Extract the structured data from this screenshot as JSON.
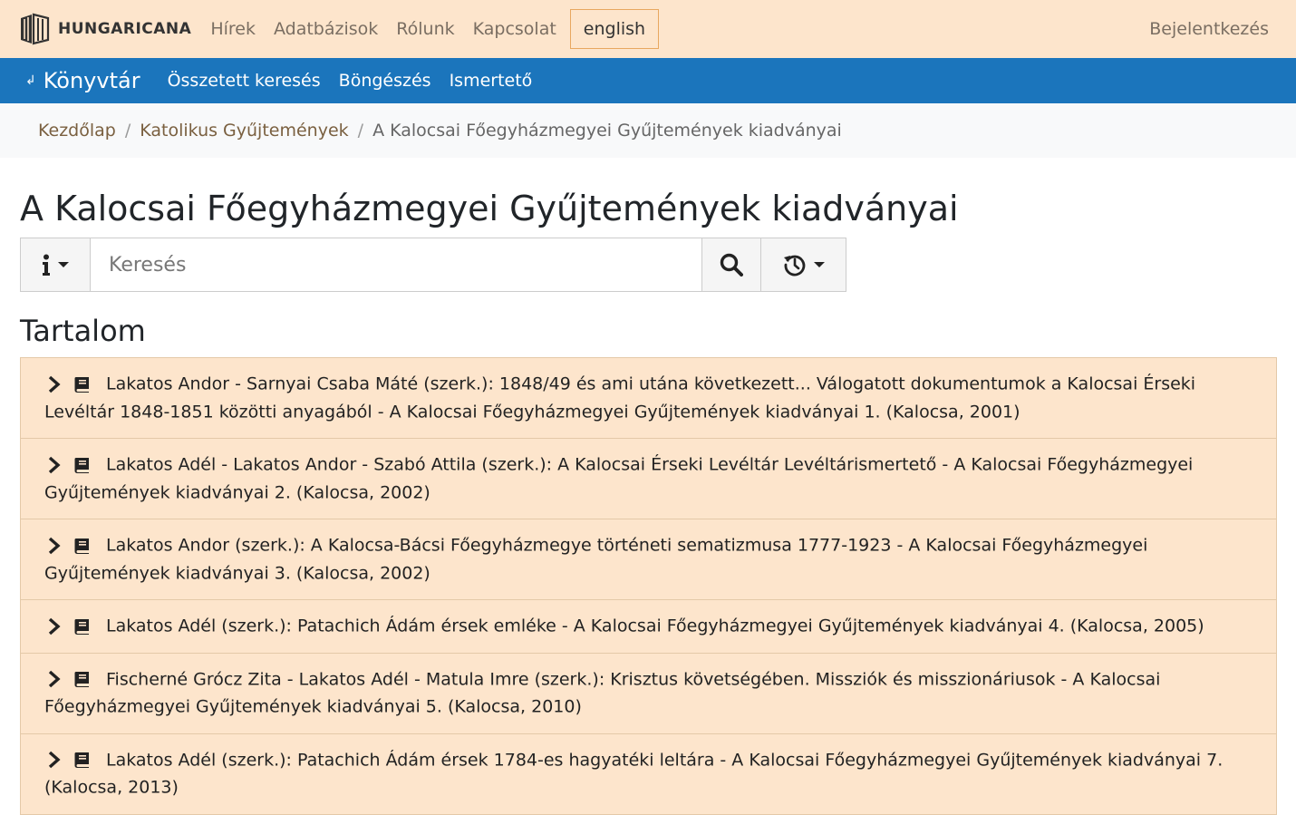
{
  "brand": {
    "name": "HUNGARICANA",
    "logo_icon": "hungaricana-logo-icon"
  },
  "top_nav": {
    "items": [
      "Hírek",
      "Adatbázisok",
      "Rólunk",
      "Kapcsolat"
    ],
    "language_button": "english",
    "login": "Bejelentkezés"
  },
  "sub_nav": {
    "home_arrow": "↲",
    "home": "Könyvtár",
    "links": [
      "Összetett keresés",
      "Böngészés",
      "Ismertető"
    ]
  },
  "breadcrumb": {
    "items": [
      "Kezdőlap",
      "Katolikus Gyűjtemények"
    ],
    "current": "A Kalocsai Főegyházmegyei Gyűjtemények kiadványai",
    "separator": "/"
  },
  "page_title": "A Kalocsai Főegyházmegyei Gyűjtemények kiadványai",
  "search": {
    "placeholder": "Keresés",
    "value": "",
    "info_icon": "info-icon",
    "search_icon": "search-icon",
    "history_icon": "history-icon"
  },
  "section_title": "Tartalom",
  "contents": {
    "items": [
      "Lakatos Andor - Sarnyai Csaba Máté (szerk.): 1848/49 és ami utána következett... Válogatott dokumentumok a Kalocsai Érseki Levéltár 1848-1851 közötti anyagából - A Kalocsai Főegyházmegyei Gyűjtemények kiadványai 1. (Kalocsa, 2001)",
      "Lakatos Adél - Lakatos Andor - Szabó Attila (szerk.): A Kalocsai Érseki Levéltár Levéltárismertető - A Kalocsai Főegyházmegyei Gyűjtemények kiadványai 2. (Kalocsa, 2002)",
      "Lakatos Andor (szerk.): A Kalocsa-Bácsi Főegyházmegye történeti sematizmusa 1777-1923 - A Kalocsai Főegyházmegyei Gyűjtemények kiadványai 3. (Kalocsa, 2002)",
      "Lakatos Adél (szerk.): Patachich Ádám érsek emléke - A Kalocsai Főegyházmegyei Gyűjtemények kiadványai 4. (Kalocsa, 2005)",
      "Fischerné Grócz Zita - Lakatos Adél - Matula Imre (szerk.): Krisztus követségében. Missziók és misszionáriusok - A Kalocsai Főegyházmegyei Gyűjtemények kiadványai 5. (Kalocsa, 2010)",
      "Lakatos Adél (szerk.): Patachich Ádám érsek 1784-es hagyatéki leltára - A Kalocsai Főegyházmegyei Gyűjtemények kiadványai 7. (Kalocsa, 2013)"
    ],
    "chevron_icon": "chevron-right-icon",
    "book_icon": "book-icon"
  },
  "colors": {
    "top_bar_bg": "#fde5cc",
    "sub_nav_bg": "#1b75bc",
    "list_item_bg": "#fde5cc",
    "breadcrumb_bg": "#f8f9fa"
  }
}
